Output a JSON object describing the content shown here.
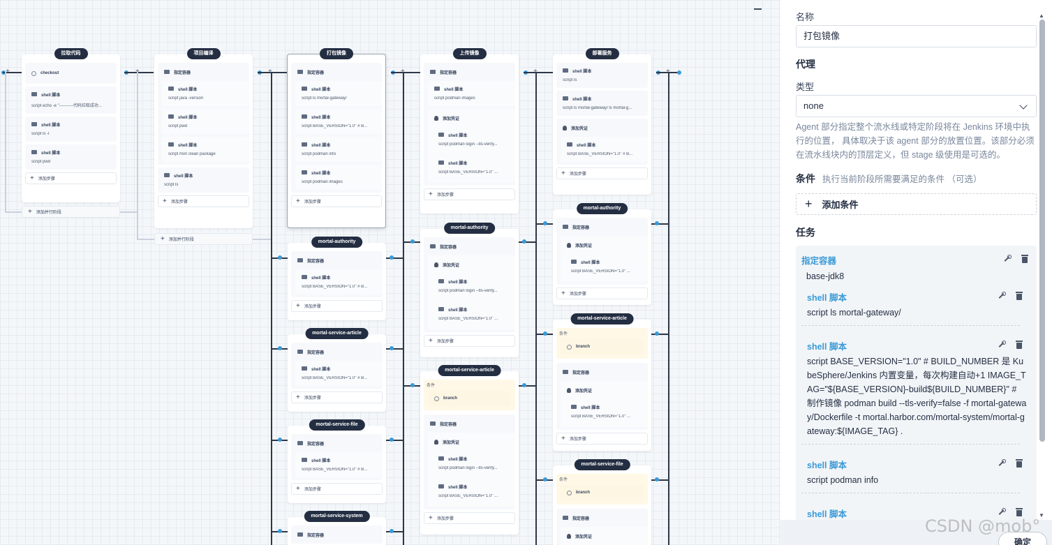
{
  "canvas": {
    "stages": [
      {
        "title": "拉取代码",
        "steps": [
          {
            "kind": "git",
            "label": "checkout"
          },
          {
            "kind": "shell",
            "label": "shell 脚本",
            "script": "script   echo -e \"----------代码拉取成功..."
          },
          {
            "kind": "shell",
            "label": "shell 脚本",
            "script": "script   ls -l"
          },
          {
            "kind": "shell",
            "label": "shell 脚本",
            "script": "script   pwd"
          }
        ],
        "add_step": "添加步骤",
        "add_parallel": "添加并行阶段"
      },
      {
        "title": "项目编译",
        "steps": [
          {
            "kind": "container",
            "label": "指定容器"
          },
          {
            "kind": "shell",
            "label": "shell 脚本",
            "script": "script   java -version"
          },
          {
            "kind": "shell",
            "label": "shell 脚本",
            "script": "script   pwd"
          },
          {
            "kind": "shell",
            "label": "shell 脚本",
            "script": "script   mvn clean package"
          },
          {
            "kind": "shell",
            "label": "shell 脚本",
            "script": "script   ls"
          }
        ],
        "add_step": "添加步骤",
        "add_parallel": "添加并行阶段"
      },
      {
        "title": "打包镜像",
        "steps": [
          {
            "kind": "container",
            "label": "指定容器"
          },
          {
            "kind": "shell",
            "label": "shell 脚本",
            "script": "script   ls mortal-gateway/"
          },
          {
            "kind": "shell",
            "label": "shell 脚本",
            "script": "script   BASE_VERSION=\"1.0\" # B..."
          },
          {
            "kind": "shell",
            "label": "shell 脚本",
            "script": "script   podman info"
          },
          {
            "kind": "shell",
            "label": "shell 脚本",
            "script": "script   podman images"
          }
        ],
        "add_step": "添加步骤"
      },
      {
        "title": "上传镜像",
        "steps": [
          {
            "kind": "container",
            "label": "指定容器"
          },
          {
            "kind": "shell",
            "label": "shell 脚本",
            "script": "script   podman images"
          },
          {
            "kind": "cred",
            "label": "添加凭证"
          },
          {
            "kind": "shell",
            "label": "shell 脚本",
            "script": "script   podman login --tls-verify..."
          },
          {
            "kind": "shell",
            "label": "shell 脚本",
            "script": "script   BASE_VERSION=\"1.0\" ..."
          }
        ],
        "add_step": "添加步骤"
      },
      {
        "title": "部署服务",
        "steps": [
          {
            "kind": "shell",
            "label": "shell 脚本",
            "script": "script   ls"
          },
          {
            "kind": "shell",
            "label": "shell 脚本",
            "script": "script   ls mortal-gateway/ ls mortal-g..."
          },
          {
            "kind": "cred",
            "label": "添加凭证"
          },
          {
            "kind": "shell",
            "label": "shell 脚本",
            "script": "script   BASE_VERSION=\"1.0\" # B..."
          }
        ],
        "add_step": "添加步骤"
      }
    ],
    "parallel_col3": [
      {
        "title": "mortal-authority",
        "container": "指定容器",
        "shell": "shell 脚本",
        "script": "script   BASE_VERSION=\"1.0\" # B...",
        "add_step": "添加步骤"
      },
      {
        "title": "mortal-service-article",
        "container": "指定容器",
        "shell": "shell 脚本",
        "script": "script   BASE_VERSION=\"1.0\" # B...",
        "add_step": "添加步骤"
      },
      {
        "title": "mortal-service-file",
        "container": "指定容器",
        "shell": "shell 脚本",
        "script": "script   BASE_VERSION=\"1.0\" # B...",
        "add_step": "添加步骤"
      },
      {
        "title": "mortal-service-system",
        "container": "指定容器"
      }
    ],
    "parallel_col4": [
      {
        "title": "mortal-authority",
        "container": "指定容器",
        "cred": "添加凭证",
        "shell1": "shell 脚本",
        "script1": "script   podman login --tls-verify...",
        "shell2": "shell 脚本",
        "script2": "script   BASE_VERSION=\"1.0\" ...",
        "add_step": "添加步骤"
      },
      {
        "title": "mortal-service-article",
        "cond_label": "条件",
        "branch": "branch",
        "container": "指定容器",
        "cred": "添加凭证",
        "shell1": "shell 脚本",
        "script1": "script   podman login --tls-verify...",
        "shell2": "shell 脚本",
        "script2": "script   BASE_VERSION=\"1.0\" ...",
        "add_step": "添加步骤"
      }
    ],
    "parallel_col5": [
      {
        "title": "mortal-authority",
        "container": "指定容器",
        "cred": "添加凭证",
        "shell": "shell 脚本",
        "script": "script   BASE_VERSION=\"1.0\" ...",
        "add_step": "添加步骤"
      },
      {
        "title": "mortal-service-article",
        "cond_label": "条件",
        "branch": "branch",
        "container": "指定容器",
        "cred": "添加凭证",
        "shell": "shell 脚本",
        "script": "script   BASE_VERSION=\"1.0\" ...",
        "add_step": "添加步骤"
      },
      {
        "title": "mortal-service-file",
        "cond_label": "条件",
        "branch": "branch",
        "container": "指定容器",
        "cred": "添加凭证"
      }
    ]
  },
  "panel": {
    "name_label": "名称",
    "name_value": "打包镜像",
    "agent_title": "代理",
    "type_label": "类型",
    "type_value": "none",
    "agent_desc": "Agent 部分指定整个流水线或特定阶段将在 Jenkins 环境中执行的位置， 具体取决于该 agent 部分的放置位置。该部分必须在流水线块内的顶层定义，但 stage 级使用是可选的。",
    "cond_title": "条件",
    "cond_hint": "执行当前阶段所需要满足的条件 （可选）",
    "add_cond": "添加条件",
    "tasks_title": "任务",
    "container_head": "指定容器",
    "container_value": "base-jdk8",
    "tasks": [
      {
        "head": "shell 脚本",
        "text": "script    ls mortal-gateway/"
      },
      {
        "head": "shell 脚本",
        "text": "script    BASE_VERSION=\"1.0\" # BUILD_NUMBER 是 KubeSphere/Jenkins 内置变量，每次构建自动+1 IMAGE_TAG=\"${BASE_VERSION}-build${BUILD_NUMBER}\" # 制作镜像 podman build --tls-verify=false -f mortal-gateway/Dockerfile -t mortal.harbor.com/mortal-system/mortal-gateway:${IMAGE_TAG} ."
      },
      {
        "head": "shell 脚本",
        "text": "script    podman info"
      },
      {
        "head": "shell 脚本",
        "text": ""
      }
    ],
    "ok_label": "确定"
  },
  "watermark": "CSDN @mob°"
}
